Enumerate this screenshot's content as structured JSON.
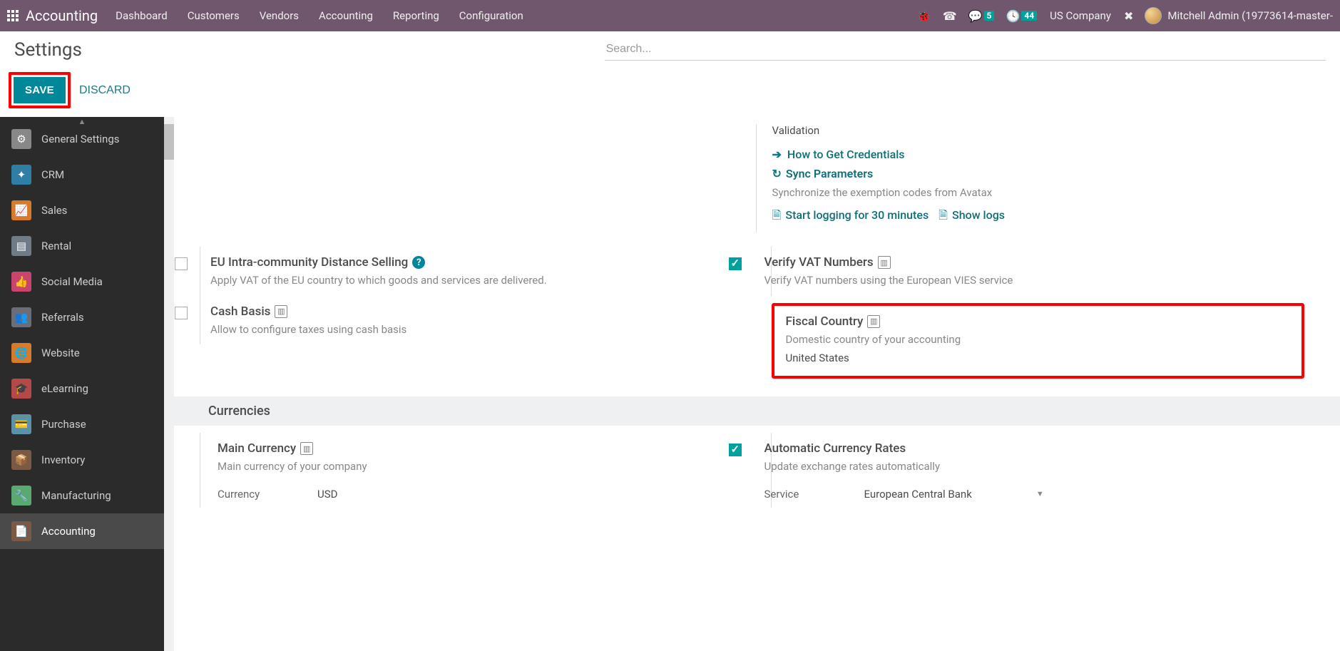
{
  "nav": {
    "brand": "Accounting",
    "items": [
      "Dashboard",
      "Customers",
      "Vendors",
      "Accounting",
      "Reporting",
      "Configuration"
    ],
    "chat_badge": "5",
    "clock_badge": "44",
    "company": "US Company",
    "user": "Mitchell Admin (19773614-master-"
  },
  "page": {
    "title": "Settings",
    "search_placeholder": "Search...",
    "save": "SAVE",
    "discard": "DISCARD"
  },
  "sidebar": {
    "items": [
      {
        "label": "General Settings",
        "color": "#888888",
        "icon": "⚙"
      },
      {
        "label": "CRM",
        "color": "#2f7ea6",
        "icon": "✦"
      },
      {
        "label": "Sales",
        "color": "#d67b2a",
        "icon": "📈"
      },
      {
        "label": "Rental",
        "color": "#6f7b87",
        "icon": "▤"
      },
      {
        "label": "Social Media",
        "color": "#c9456b",
        "icon": "👍"
      },
      {
        "label": "Referrals",
        "color": "#6b6e76",
        "icon": "👥"
      },
      {
        "label": "Website",
        "color": "#d67b2a",
        "icon": "🌐"
      },
      {
        "label": "eLearning",
        "color": "#b54848",
        "icon": "🎓"
      },
      {
        "label": "Purchase",
        "color": "#5c92a8",
        "icon": "💳"
      },
      {
        "label": "Inventory",
        "color": "#7a5a45",
        "icon": "📦"
      },
      {
        "label": "Manufacturing",
        "color": "#5aa971",
        "icon": "🔧"
      },
      {
        "label": "Accounting",
        "color": "#7a5a45",
        "icon": "📄",
        "active": true
      }
    ]
  },
  "settings": {
    "validation_label": "Validation",
    "how_to_link": "How to Get Credentials",
    "sync_title": "Sync Parameters",
    "sync_desc": "Synchronize the exemption codes from Avatax",
    "start_logging": "Start logging for 30 minutes",
    "show_logs": "Show logs",
    "eu_title": "EU Intra-community Distance Selling",
    "eu_desc": "Apply VAT of the EU country to which goods and services are delivered.",
    "vat_title": "Verify VAT Numbers",
    "vat_desc": "Verify VAT numbers using the European VIES service",
    "cash_title": "Cash Basis",
    "cash_desc": "Allow to configure taxes using cash basis",
    "fiscal_title": "Fiscal Country",
    "fiscal_desc": "Domestic country of your accounting",
    "fiscal_value": "United States",
    "currencies_header": "Currencies",
    "main_currency_title": "Main Currency",
    "main_currency_desc": "Main currency of your company",
    "currency_label": "Currency",
    "currency_value": "USD",
    "auto_rates_title": "Automatic Currency Rates",
    "auto_rates_desc": "Update exchange rates automatically",
    "service_label": "Service",
    "service_value": "European Central Bank"
  }
}
